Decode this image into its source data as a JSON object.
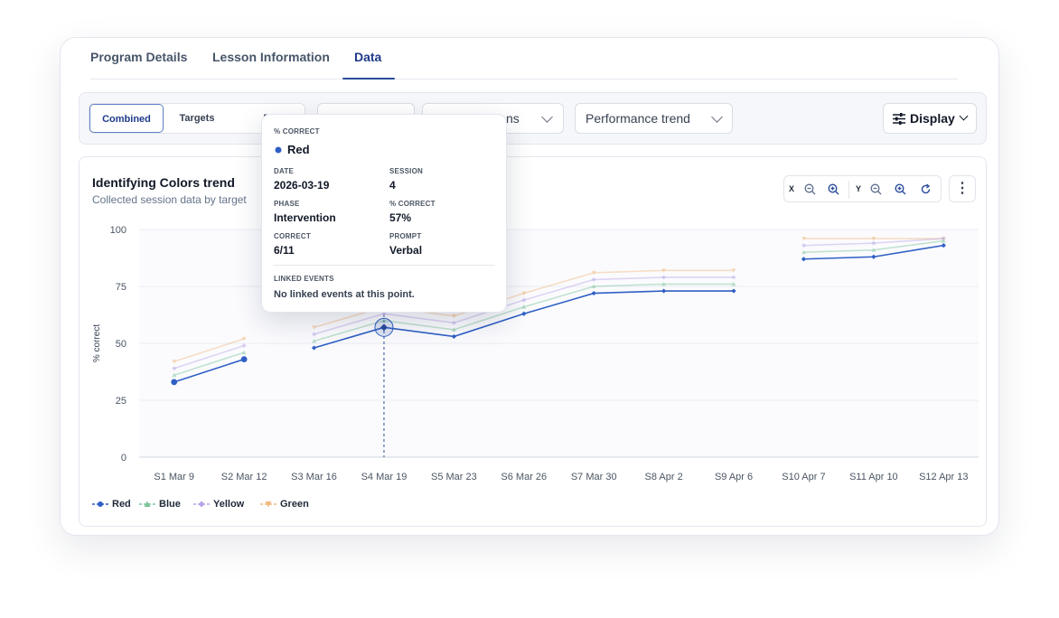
{
  "tabs": [
    {
      "label": "Program Details"
    },
    {
      "label": "Lesson Information"
    },
    {
      "label": "Data",
      "active": true
    }
  ],
  "toolbar": {
    "view_options": [
      "Combined",
      "Targets",
      "P"
    ],
    "active_view": "Combined",
    "dropdown_partial_label": "ns",
    "trend_select": "Performance trend",
    "display_label": "Display"
  },
  "chart_header": {
    "title": "Identifying Colors trend",
    "subtitle": "Collected session data by target",
    "zoom_x_label": "X",
    "zoom_y_label": "Y"
  },
  "tooltip": {
    "heading": "% CORRECT",
    "series": "Red",
    "fields": [
      {
        "label": "DATE",
        "value": "2026-03-19"
      },
      {
        "label": "SESSION",
        "value": "4"
      },
      {
        "label": "PHASE",
        "value": "Intervention"
      },
      {
        "label": "% CORRECT",
        "value": "57%"
      },
      {
        "label": "CORRECT",
        "value": "6/11"
      },
      {
        "label": "PROMPT",
        "value": "Verbal"
      }
    ],
    "linked_label": "LINKED EVENTS",
    "linked_value": "No linked events at this point."
  },
  "colors": {
    "red": "#2f5fc4",
    "blue": "#7cc39a",
    "yellow": "#b7a3e6",
    "green": "#f0b97e",
    "accent": "#2b4c9b"
  },
  "chart_data": {
    "type": "line",
    "ylabel": "% correct",
    "ylim": [
      0,
      100
    ],
    "yticks": [
      0,
      25,
      50,
      75,
      100
    ],
    "categories": [
      "S1 Mar 9",
      "S2 Mar 12",
      "S3 Mar 16",
      "S4 Mar 19",
      "S5 Mar 23",
      "S6 Mar 26",
      "S7 Mar 30",
      "S8 Apr 2",
      "S9 Apr 6",
      "S10 Apr 7",
      "S11 Apr 10",
      "S12 Apr 13"
    ],
    "segments": [
      [
        0,
        1
      ],
      [
        2,
        3,
        4,
        5,
        6,
        7,
        8
      ],
      [
        9,
        10,
        11
      ]
    ],
    "highlight_index": 3,
    "series": [
      {
        "name": "Red",
        "color": "#2f5fc4",
        "marker": "circle",
        "values": [
          33,
          43,
          48,
          57,
          53,
          63,
          72,
          73,
          73,
          87,
          88,
          93
        ]
      },
      {
        "name": "Blue",
        "color": "#7cc39a",
        "marker": "triangle",
        "values": [
          36,
          46,
          51,
          60,
          56,
          66,
          75,
          76,
          76,
          90,
          91,
          95
        ]
      },
      {
        "name": "Yellow",
        "color": "#b7a3e6",
        "marker": "diamond",
        "values": [
          39,
          49,
          54,
          63,
          59,
          69,
          78,
          79,
          79,
          93,
          94,
          96
        ]
      },
      {
        "name": "Green",
        "color": "#f0b97e",
        "marker": "triangle-down",
        "values": [
          42,
          52,
          57,
          66,
          62,
          72,
          81,
          82,
          82,
          96,
          96,
          96
        ]
      }
    ]
  }
}
